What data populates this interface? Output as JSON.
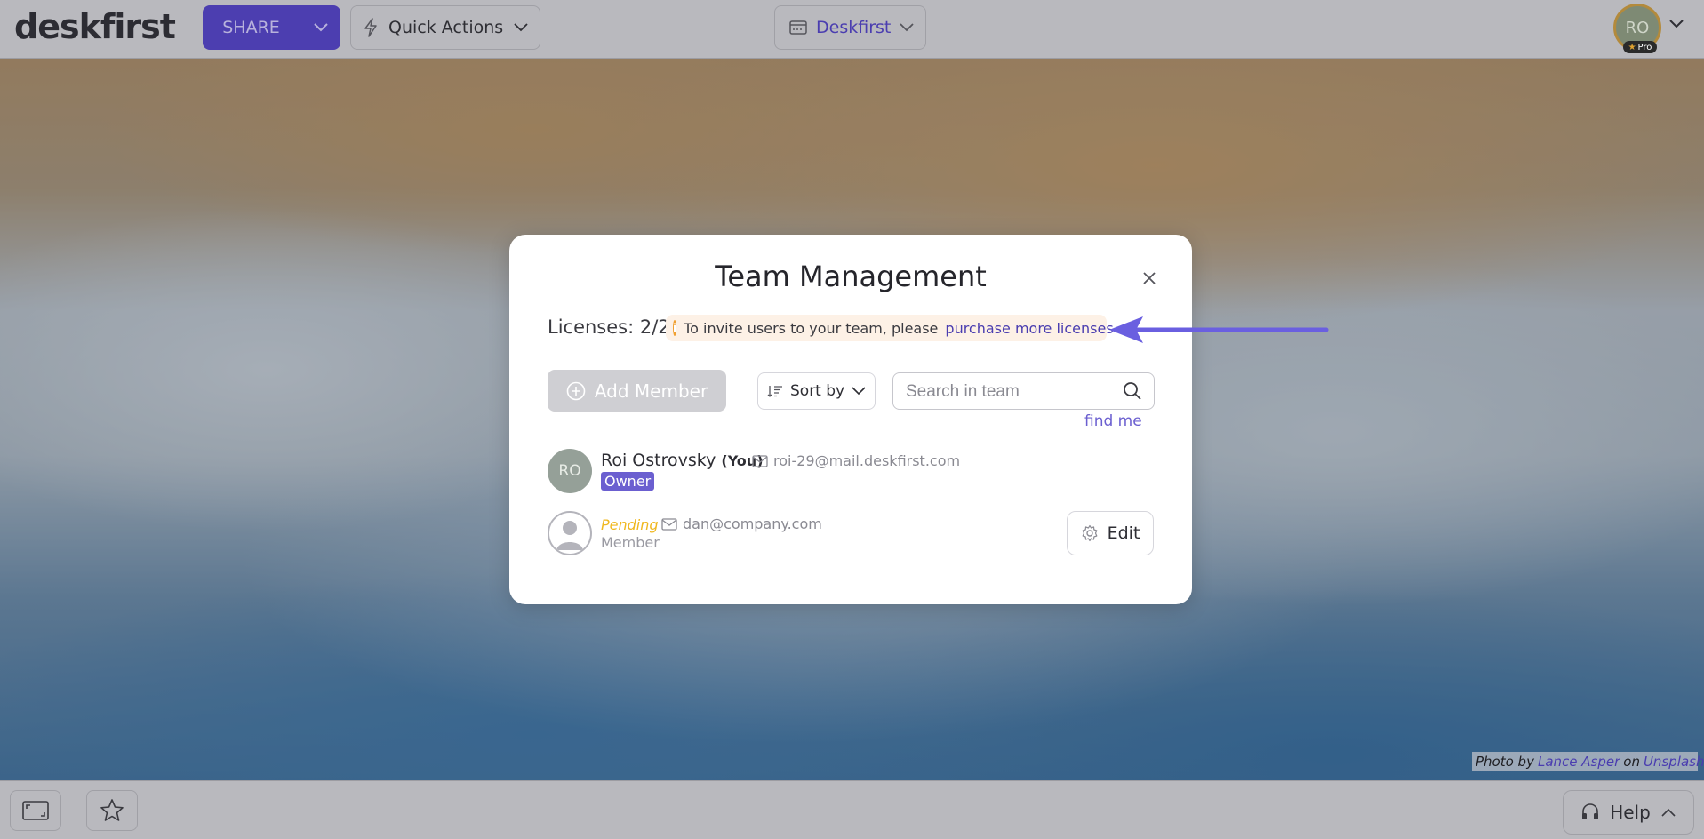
{
  "app": {
    "logo": "deskfirst"
  },
  "topbar": {
    "share_label": "SHARE",
    "quick_actions_label": "Quick Actions",
    "workspace_label": "Deskfirst",
    "avatar_initials": "RO",
    "pro_label": "Pro"
  },
  "modal": {
    "title": "Team Management",
    "licenses_label": "Licenses: 2/2",
    "info_text": "To invite users to your team, please",
    "info_link": "purchase more licenses",
    "add_member_label": "Add Member",
    "sort_label": "Sort by",
    "search_placeholder": "Search in team",
    "find_me": "find me",
    "members": [
      {
        "initials": "RO",
        "name": "Roi Ostrovsky",
        "you": "(You)",
        "email": "roi-29@mail.deskfirst.com",
        "role": "Owner"
      },
      {
        "status": "Pending",
        "email": "dan@company.com",
        "role": "Member",
        "action": "Edit"
      }
    ]
  },
  "bottombar": {
    "help_label": "Help"
  },
  "credit": {
    "prefix": "Photo by",
    "author": "Lance Asper",
    "middle": "on",
    "site": "Unsplash"
  },
  "colors": {
    "accent": "#4a3db0",
    "owner_badge": "#6b5fd0",
    "pending": "#f0b820",
    "info_bg": "#fdf1e6"
  },
  "icons": [
    "chevron-down-icon",
    "lightning-icon",
    "window-icon",
    "close-icon",
    "info-icon",
    "plus-circle-icon",
    "sort-icon",
    "search-icon",
    "mail-icon",
    "user-icon",
    "gear-icon",
    "fullscreen-icon",
    "star-icon",
    "headset-icon",
    "chevron-up-icon",
    "arrow-icon"
  ]
}
